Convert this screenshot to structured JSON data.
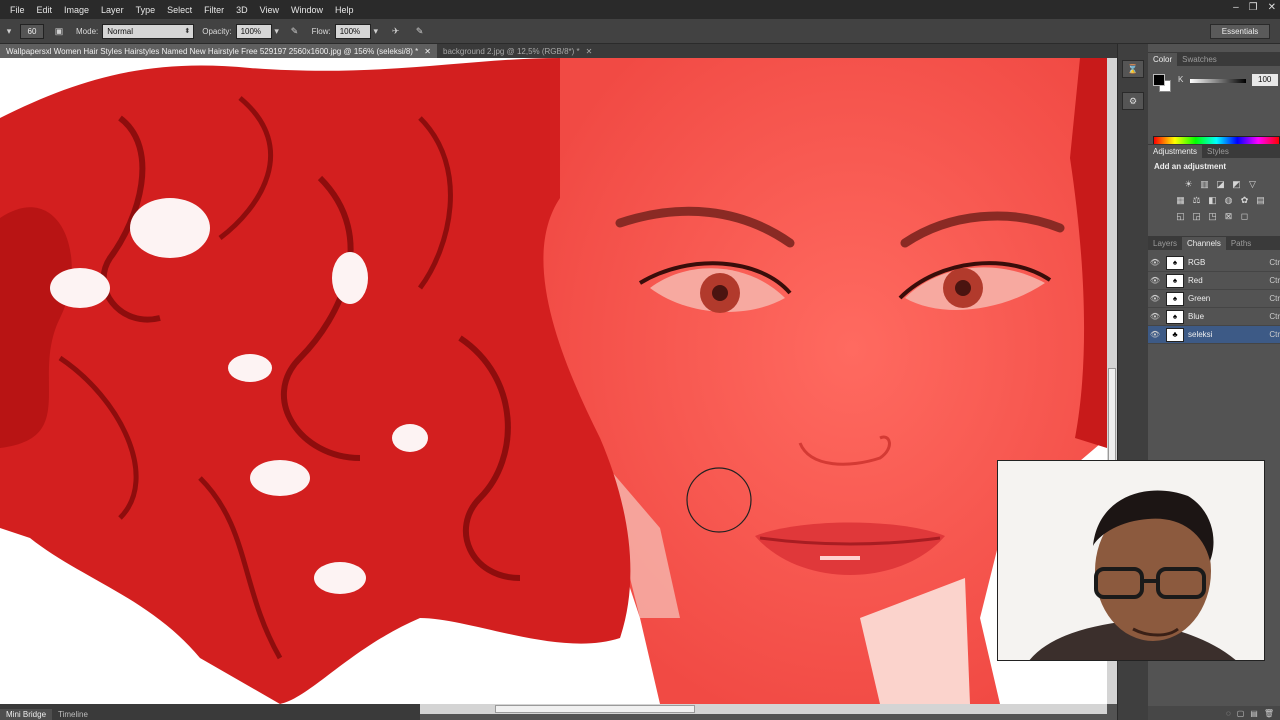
{
  "menu": [
    "File",
    "Edit",
    "Image",
    "Layer",
    "Type",
    "Select",
    "Filter",
    "3D",
    "View",
    "Window",
    "Help"
  ],
  "window_controls": [
    "minimize-icon",
    "restore-icon",
    "close-icon"
  ],
  "options": {
    "brush_size": "60",
    "mode_label": "Mode:",
    "mode_value": "Normal",
    "opacity_label": "Opacity:",
    "opacity_value": "100%",
    "flow_label": "Flow:",
    "flow_value": "100%",
    "workspace": "Essentials"
  },
  "doc_tabs": [
    {
      "title": "Wallpapersxl Women Hair Styles Hairstyles Named New Hairstyle Free 529197 2560x1600.jpg @ 156% (seleksi/8) *",
      "active": true
    },
    {
      "title": "background 2.jpg @ 12,5% (RGB/8*) *",
      "active": false
    }
  ],
  "bottom_tabs": [
    "Mini Bridge",
    "Timeline"
  ],
  "color_panel": {
    "tabs": [
      "Color",
      "Swatches"
    ],
    "channel_label": "K",
    "value": "100",
    "fg": "#000000",
    "bg": "#ffffff"
  },
  "adjustments_panel": {
    "tabs": [
      "Adjustments",
      "Styles"
    ],
    "heading": "Add an adjustment"
  },
  "channels_panel": {
    "tabs": [
      "Layers",
      "Channels",
      "Paths"
    ],
    "rows": [
      {
        "name": "RGB",
        "shortcut": "Ctr",
        "selected": false
      },
      {
        "name": "Red",
        "shortcut": "Ctr",
        "selected": false
      },
      {
        "name": "Green",
        "shortcut": "Ctr",
        "selected": false
      },
      {
        "name": "Blue",
        "shortcut": "Ctr",
        "selected": false
      },
      {
        "name": "seleksi",
        "shortcut": "Ctr",
        "selected": true
      }
    ]
  },
  "colors": {
    "quick_mask_overlay": "#ff3333",
    "hair": "#cc1a1a",
    "panel": "#535353",
    "selected_row": "#3d5a86"
  }
}
